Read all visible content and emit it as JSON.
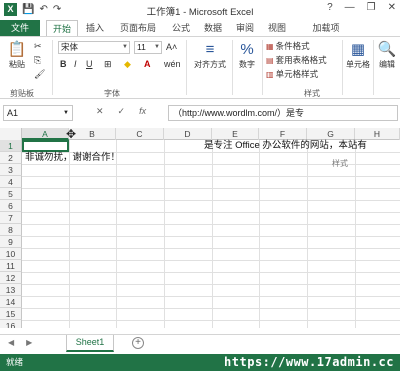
{
  "window": {
    "title": "工作簿1 - Microsoft Excel",
    "help": "?",
    "minimize": "—",
    "restore": "❐",
    "close": "✕"
  },
  "qat": {
    "logo": "X",
    "save_icon": "save-icon",
    "undo_icon": "undo-icon",
    "redo_icon": "redo-icon"
  },
  "tabs": [
    {
      "label": "文件"
    },
    {
      "label": "开始"
    },
    {
      "label": "插入"
    },
    {
      "label": "页面布局"
    },
    {
      "label": "公式"
    },
    {
      "label": "数据"
    },
    {
      "label": "审阅"
    },
    {
      "label": "视图"
    },
    {
      "label": "加载项"
    }
  ],
  "ribbon": {
    "clipboard": {
      "label": "剪贴板",
      "paste": "粘贴"
    },
    "font": {
      "label": "字体",
      "name": "宋体",
      "size": "11"
    },
    "alignment": {
      "label": "对齐方式"
    },
    "number": {
      "label": "数字",
      "symbol": "%"
    },
    "styles": {
      "label": "样式",
      "conditional": "条件格式",
      "table": "套用表格格式",
      "cell": "单元格样式"
    },
    "cells": {
      "label": "单元格"
    },
    "editing": {
      "label": "编辑"
    }
  },
  "formula_bar": {
    "name_box": "A1",
    "cancel": "✕",
    "enter": "✓",
    "fx": "fx",
    "content": "（http://www.wordlm.com/）是专"
  },
  "grid": {
    "columns": [
      "A",
      "B",
      "C",
      "D",
      "E",
      "F",
      "G",
      "H"
    ],
    "rows": [
      "1",
      "2",
      "3",
      "4",
      "5",
      "6",
      "7",
      "8",
      "9",
      "10",
      "11",
      "12",
      "13",
      "14",
      "15",
      "16"
    ],
    "b1_text": "是专注 Office 办公软件的网站，本站有",
    "a2_text": "非诚勿扰，谢谢合作！",
    "ghost_label": "样式"
  },
  "sheets": {
    "active": "Sheet1",
    "add": "+"
  },
  "status": {
    "ready": "就绪",
    "watermark": "https://www.17admin.cc"
  },
  "colors": {
    "accent": "#217346",
    "ribbon_icon": "#2b579a"
  }
}
